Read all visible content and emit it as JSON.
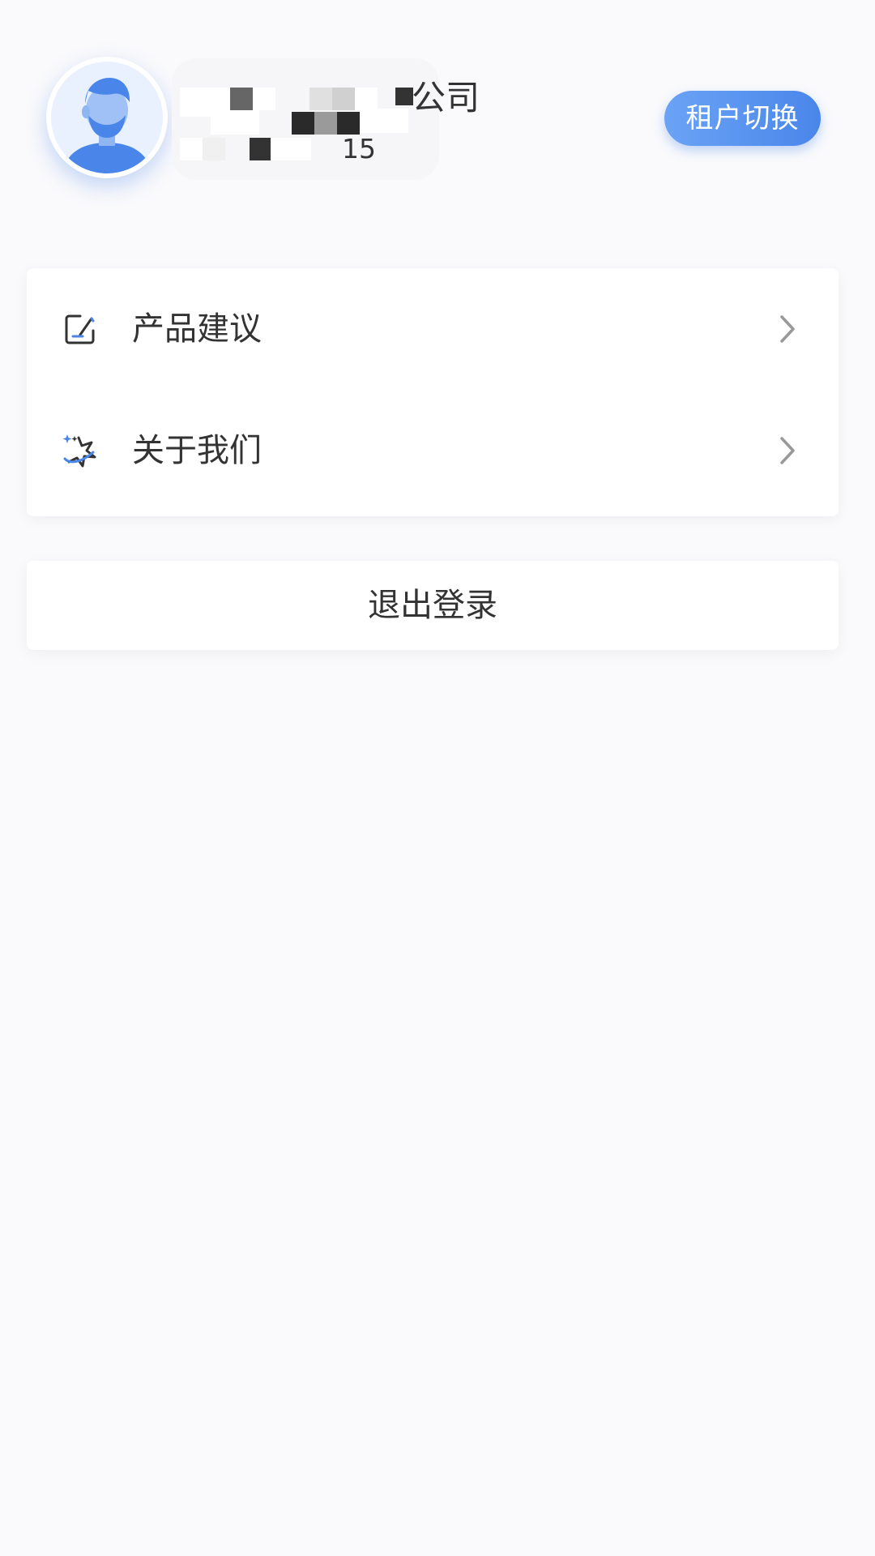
{
  "profile": {
    "company_name_visible": "公司",
    "sub_text_visible": "15",
    "tenant_switch_label": "租户切换",
    "avatar_icon": "user-avatar-icon"
  },
  "menu": {
    "items": [
      {
        "label": "产品建议",
        "icon": "feedback-edit-icon"
      },
      {
        "label": "关于我们",
        "icon": "star-sparkle-icon"
      }
    ]
  },
  "logout": {
    "label": "退出登录"
  },
  "colors": {
    "accent": "#4a86ea",
    "accent_light": "#6aa3f5",
    "background": "#fafafc",
    "text": "#333333",
    "chevron": "#999999"
  }
}
